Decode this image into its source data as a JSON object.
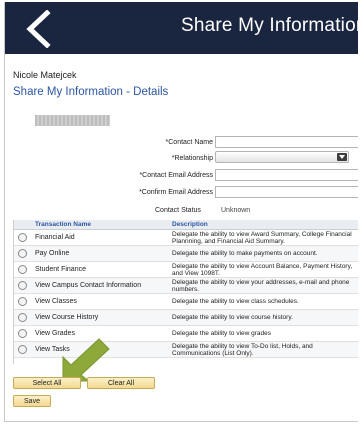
{
  "header": {
    "title": "Share My Information",
    "back_icon": "chevron-left-icon",
    "background": "#1a2540"
  },
  "user": {
    "name": "Nicole Matejcek"
  },
  "page": {
    "title": "Share My Information - Details"
  },
  "form": {
    "contact_name_label": "*Contact Name",
    "relationship_label": "*Relationship",
    "contact_email_label": "*Contact Email Address",
    "confirm_email_label": "*Confirm Email Address",
    "contact_name_value": "",
    "contact_email_value": "",
    "confirm_email_value": "",
    "relationship_value": ""
  },
  "status": {
    "label": "Contact Status",
    "value": "Unknown"
  },
  "table": {
    "columns": [
      "Transaction Name",
      "Description"
    ],
    "rows": [
      {
        "name": "Financial Aid",
        "description": "Delegate the ability to view Award Summary, College Financial Plannning, and Financial Aid Summary."
      },
      {
        "name": "Pay Online",
        "description": "Delegate the ability to make payments on account."
      },
      {
        "name": "Student Finance",
        "description": "Delegate the ability to view Account Balance, Payment History, and View 1098T."
      },
      {
        "name": "View Campus Contact Information",
        "description": "Delegate the ability to view your addresses, e-mail and phone numbers."
      },
      {
        "name": "View Classes",
        "description": "Delegate the ability to view class schedules."
      },
      {
        "name": "View Course History",
        "description": "Delegate the ability to view course history."
      },
      {
        "name": "View Grades",
        "description": "Delegate the ability to view grades"
      },
      {
        "name": "View Tasks",
        "description": "Delegate the ability to view To-Do list, Holds, and Communications (List Only)."
      }
    ]
  },
  "buttons": {
    "select_all": "Select All",
    "clear_all": "Clear All",
    "save": "Save"
  },
  "colors": {
    "accent": "#2c56a3",
    "pointer_arrow": "#8ca93a",
    "button_fill": "#f1d98f"
  }
}
